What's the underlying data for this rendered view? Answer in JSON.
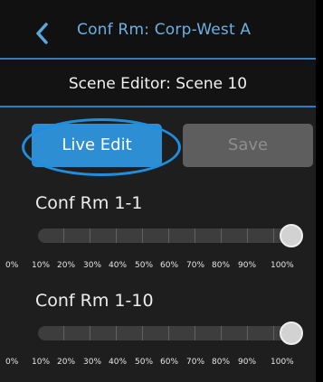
{
  "header": {
    "title": "Conf Rm: Corp-West A",
    "back_icon": "chevron-left-icon",
    "accent_color": "#6db0e2"
  },
  "subheader": {
    "title": "Scene Editor: Scene 10"
  },
  "buttons": {
    "live_edit": "Live Edit",
    "save": "Save"
  },
  "channels": [
    {
      "label": "Conf Rm 1-1",
      "level_percent": 96
    },
    {
      "label": "Conf Rm 1-10",
      "level_percent": 96
    }
  ],
  "scale_labels": [
    "0%",
    "10%",
    "20%",
    "30%",
    "40%",
    "50%",
    "60%",
    "70%",
    "80%",
    "90%",
    "100%"
  ]
}
